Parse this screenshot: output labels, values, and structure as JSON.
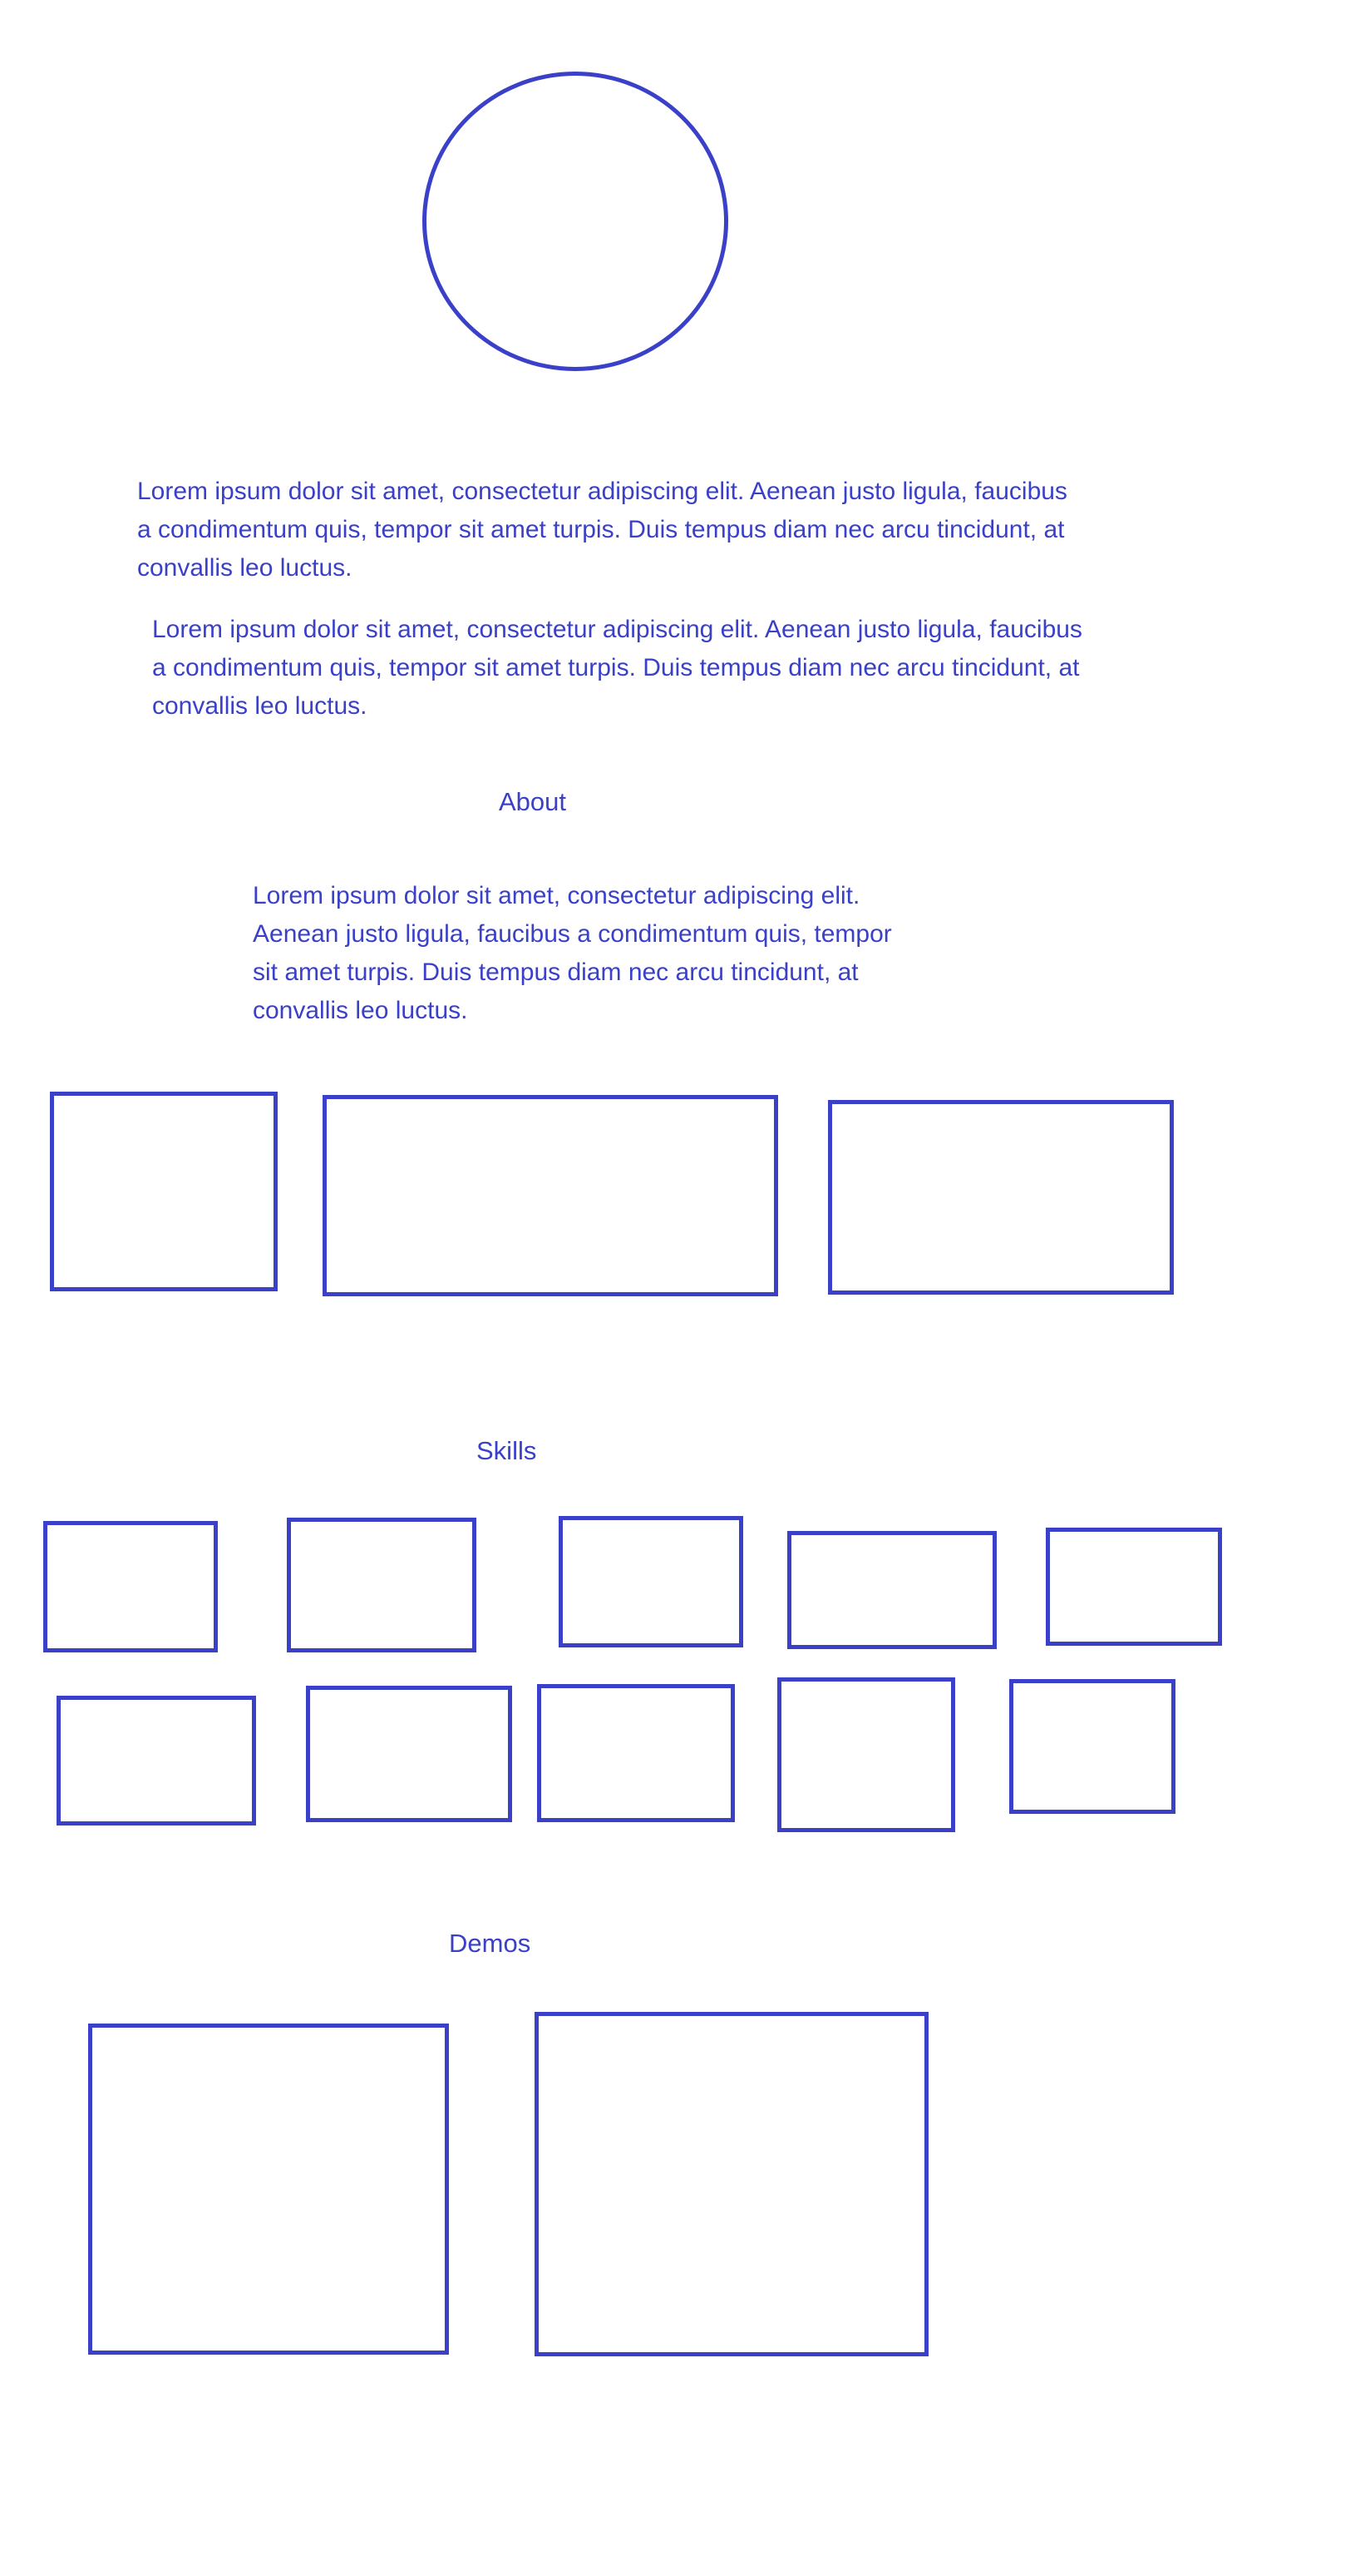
{
  "intro": {
    "paragraph_1": "Lorem ipsum dolor sit amet, consectetur adipiscing elit. Aenean justo ligula, faucibus a condimentum quis, tempor sit amet turpis. Duis tempus diam nec arcu tincidunt, at convallis leo luctus.",
    "paragraph_2": "Lorem ipsum dolor sit amet, consectetur adipiscing elit. Aenean justo ligula, faucibus a condimentum quis, tempor sit amet turpis. Duis tempus diam nec arcu tincidunt, at convallis leo luctus."
  },
  "about": {
    "heading": "About",
    "paragraph": "Lorem ipsum dolor sit amet, consectetur adipiscing elit. Aenean justo ligula, faucibus a condimentum quis, tempor sit amet turpis. Duis tempus diam nec arcu tincidunt, at convallis leo luctus."
  },
  "skills": {
    "heading": "Skills"
  },
  "demos": {
    "heading": "Demos"
  },
  "colors": {
    "stroke": "#3a40c8",
    "background": "#ffffff"
  }
}
